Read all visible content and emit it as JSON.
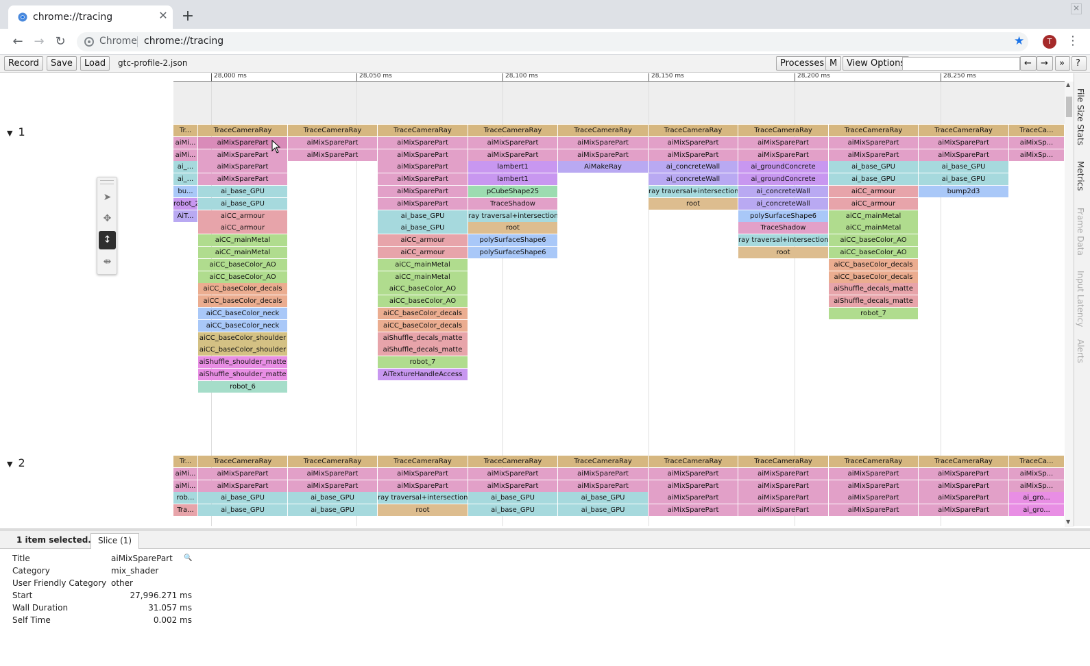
{
  "browser": {
    "tab_title": "chrome://tracing",
    "new_tab_symbol": "+",
    "close_symbol": "✕",
    "window_close_symbol": "✕",
    "omnibox_chip": "Chrome",
    "url": "chrome://tracing",
    "avatar_initial": "T",
    "nav_icons": [
      "back-arrow-icon",
      "forward-arrow-icon",
      "reload-icon"
    ],
    "accent": "#1a73e8",
    "avatar_color": "#a52a2a"
  },
  "tracing": {
    "buttons": {
      "record": "Record",
      "save": "Save",
      "load": "Load",
      "processes": "Processes",
      "m": "M",
      "view_options": "View Options",
      "prev": "←",
      "next": "→",
      "more": "»",
      "help": "?"
    },
    "filename": "gtc-profile-2.json",
    "search_value": "",
    "ruler_labels": [
      "28,000 ms",
      "28,050 ms",
      "28,100 ms",
      "28,150 ms",
      "28,200 ms",
      "28,250 ms"
    ],
    "threads": [
      {
        "id": "1",
        "expanded": true
      },
      {
        "id": "2",
        "expanded": true
      }
    ],
    "side_tabs": [
      "File Size Stats",
      "Metrics",
      "Frame Data",
      "Input Latency",
      "Alerts"
    ],
    "mouse_modes": [
      "selection-mode-icon",
      "pan-mode-icon",
      "zoom-mode-icon",
      "timing-mode-icon"
    ],
    "colors": {
      "tan": "#d6b780",
      "pink": "#e2a0c8",
      "pinkSel": "#d98bb9",
      "cyan": "#a6d9dd",
      "purple": "#c897f0",
      "lav": "#b9a9f2",
      "red": "#e7a4aa",
      "green": "#b0dc8e",
      "salmon": "#ebad90",
      "blue": "#a9c8f8",
      "olive": "#d4c184",
      "magenta": "#e88ee4",
      "teal": "#a5ddc9",
      "mint": "#9cdcb0",
      "sand": "#ddbd8f"
    },
    "columns": [
      {
        "blocks1": [
          [
            "Tr...",
            "tan"
          ],
          [
            "aiMi...",
            "pink"
          ],
          [
            "aiMi...",
            "pink"
          ],
          [
            "ai_...",
            "cyan"
          ],
          [
            "ai_...",
            "cyan"
          ],
          [
            "bu...",
            "blue"
          ],
          [
            "robot_2",
            "purple"
          ],
          [
            "AiT...",
            "lav"
          ]
        ],
        "blocks2": [
          [
            "Tr...",
            "tan"
          ],
          [
            "aiMi...",
            "pink"
          ],
          [
            "aiMi...",
            "pink"
          ],
          [
            "rob...",
            "cyan"
          ],
          [
            "Tra...",
            "red"
          ]
        ]
      },
      {
        "blocks1": [
          [
            "TraceCameraRay",
            "tan"
          ],
          [
            "aiMixSparePart",
            "pinkSel"
          ],
          [
            "aiMixSparePart",
            "pink"
          ],
          [
            "aiMixSparePart",
            "pink"
          ],
          [
            "aiMixSparePart",
            "pink"
          ],
          [
            "ai_base_GPU",
            "cyan"
          ],
          [
            "ai_base_GPU",
            "cyan"
          ],
          [
            "aiCC_armour",
            "red"
          ],
          [
            "aiCC_armour",
            "red"
          ],
          [
            "aiCC_mainMetal",
            "green"
          ],
          [
            "aiCC_mainMetal",
            "green"
          ],
          [
            "aiCC_baseColor_AO",
            "green"
          ],
          [
            "aiCC_baseColor_AO",
            "green"
          ],
          [
            "aiCC_baseColor_decals",
            "salmon"
          ],
          [
            "aiCC_baseColor_decals",
            "salmon"
          ],
          [
            "aiCC_baseColor_neck",
            "blue"
          ],
          [
            "aiCC_baseColor_neck",
            "blue"
          ],
          [
            "aiCC_baseColor_shoulder",
            "olive"
          ],
          [
            "aiCC_baseColor_shoulder",
            "olive"
          ],
          [
            "aiShuffle_shoulder_matte",
            "magenta"
          ],
          [
            "aiShuffle_shoulder_matte",
            "magenta"
          ],
          [
            "robot_6",
            "teal"
          ]
        ],
        "blocks2": [
          [
            "TraceCameraRay",
            "tan"
          ],
          [
            "aiMixSparePart",
            "pink"
          ],
          [
            "aiMixSparePart",
            "pink"
          ],
          [
            "ai_base_GPU",
            "cyan"
          ],
          [
            "ai_base_GPU",
            "cyan"
          ]
        ]
      },
      {
        "blocks1": [
          [
            "TraceCameraRay",
            "tan"
          ],
          [
            "aiMixSparePart",
            "pink"
          ],
          [
            "aiMixSparePart",
            "pink"
          ]
        ],
        "blocks2": [
          [
            "TraceCameraRay",
            "tan"
          ],
          [
            "aiMixSparePart",
            "pink"
          ],
          [
            "aiMixSparePart",
            "pink"
          ],
          [
            "ai_base_GPU",
            "cyan"
          ],
          [
            "ai_base_GPU",
            "cyan"
          ]
        ]
      },
      {
        "blocks1": [
          [
            "TraceCameraRay",
            "tan"
          ],
          [
            "aiMixSparePart",
            "pink"
          ],
          [
            "aiMixSparePart",
            "pink"
          ],
          [
            "aiMixSparePart",
            "pink"
          ],
          [
            "aiMixSparePart",
            "pink"
          ],
          [
            "aiMixSparePart",
            "pink"
          ],
          [
            "aiMixSparePart",
            "pink"
          ],
          [
            "ai_base_GPU",
            "cyan"
          ],
          [
            "ai_base_GPU",
            "cyan"
          ],
          [
            "aiCC_armour",
            "red"
          ],
          [
            "aiCC_armour",
            "red"
          ],
          [
            "aiCC_mainMetal",
            "green"
          ],
          [
            "aiCC_mainMetal",
            "green"
          ],
          [
            "aiCC_baseColor_AO",
            "green"
          ],
          [
            "aiCC_baseColor_AO",
            "green"
          ],
          [
            "aiCC_baseColor_decals",
            "salmon"
          ],
          [
            "aiCC_baseColor_decals",
            "salmon"
          ],
          [
            "aiShuffle_decals_matte",
            "red"
          ],
          [
            "aiShuffle_decals_matte",
            "red"
          ],
          [
            "robot_7",
            "green"
          ],
          [
            "AiTextureHandleAccess",
            "purple"
          ]
        ],
        "blocks2": [
          [
            "TraceCameraRay",
            "tan"
          ],
          [
            "aiMixSparePart",
            "pink"
          ],
          [
            "aiMixSparePart",
            "pink"
          ],
          [
            "ray traversal+intersection",
            "cyan"
          ],
          [
            "root",
            "sand"
          ]
        ]
      },
      {
        "blocks1": [
          [
            "TraceCameraRay",
            "tan"
          ],
          [
            "aiMixSparePart",
            "pink"
          ],
          [
            "aiMixSparePart",
            "pink"
          ],
          [
            "lambert1",
            "purple"
          ],
          [
            "lambert1",
            "purple"
          ],
          [
            "pCubeShape25",
            "mint"
          ],
          [
            "TraceShadow",
            "pink"
          ],
          [
            "ray traversal+intersection",
            "cyan"
          ],
          [
            "root",
            "sand"
          ],
          [
            "polySurfaceShape6",
            "blue"
          ],
          [
            "polySurfaceShape6",
            "blue"
          ]
        ],
        "blocks2": [
          [
            "TraceCameraRay",
            "tan"
          ],
          [
            "aiMixSparePart",
            "pink"
          ],
          [
            "aiMixSparePart",
            "pink"
          ],
          [
            "ai_base_GPU",
            "cyan"
          ],
          [
            "ai_base_GPU",
            "cyan"
          ]
        ]
      },
      {
        "blocks1": [
          [
            "TraceCameraRay",
            "tan"
          ],
          [
            "aiMixSparePart",
            "pink"
          ],
          [
            "aiMixSparePart",
            "pink"
          ],
          [
            "AiMakeRay",
            "lav"
          ]
        ],
        "blocks2": [
          [
            "TraceCameraRay",
            "tan"
          ],
          [
            "aiMixSparePart",
            "pink"
          ],
          [
            "aiMixSparePart",
            "pink"
          ],
          [
            "ai_base_GPU",
            "cyan"
          ],
          [
            "ai_base_GPU",
            "cyan"
          ]
        ]
      },
      {
        "blocks1": [
          [
            "TraceCameraRay",
            "tan"
          ],
          [
            "aiMixSparePart",
            "pink"
          ],
          [
            "aiMixSparePart",
            "pink"
          ],
          [
            "ai_concreteWall",
            "lav"
          ],
          [
            "ai_concreteWall",
            "lav"
          ],
          [
            "ray traversal+intersection",
            "cyan"
          ],
          [
            "root",
            "sand"
          ]
        ],
        "blocks2": [
          [
            "TraceCameraRay",
            "tan"
          ],
          [
            "aiMixSparePart",
            "pink"
          ],
          [
            "aiMixSparePart",
            "pink"
          ],
          [
            "aiMixSparePart",
            "pink"
          ],
          [
            "aiMixSparePart",
            "pink"
          ]
        ]
      },
      {
        "blocks1": [
          [
            "TraceCameraRay",
            "tan"
          ],
          [
            "aiMixSparePart",
            "pink"
          ],
          [
            "aiMixSparePart",
            "pink"
          ],
          [
            "ai_groundConcrete",
            "purple"
          ],
          [
            "ai_groundConcrete",
            "purple"
          ],
          [
            "ai_concreteWall",
            "lav"
          ],
          [
            "ai_concreteWall",
            "lav"
          ],
          [
            "polySurfaceShape6",
            "blue"
          ],
          [
            "TraceShadow",
            "pink"
          ],
          [
            "ray traversal+intersection",
            "cyan"
          ],
          [
            "root",
            "sand"
          ]
        ],
        "blocks2": [
          [
            "TraceCameraRay",
            "tan"
          ],
          [
            "aiMixSparePart",
            "pink"
          ],
          [
            "aiMixSparePart",
            "pink"
          ],
          [
            "aiMixSparePart",
            "pink"
          ],
          [
            "aiMixSparePart",
            "pink"
          ]
        ]
      },
      {
        "blocks1": [
          [
            "TraceCameraRay",
            "tan"
          ],
          [
            "aiMixSparePart",
            "pink"
          ],
          [
            "aiMixSparePart",
            "pink"
          ],
          [
            "ai_base_GPU",
            "cyan"
          ],
          [
            "ai_base_GPU",
            "cyan"
          ],
          [
            "aiCC_armour",
            "red"
          ],
          [
            "aiCC_armour",
            "red"
          ],
          [
            "aiCC_mainMetal",
            "green"
          ],
          [
            "aiCC_mainMetal",
            "green"
          ],
          [
            "aiCC_baseColor_AO",
            "green"
          ],
          [
            "aiCC_baseColor_AO",
            "green"
          ],
          [
            "aiCC_baseColor_decals",
            "salmon"
          ],
          [
            "aiCC_baseColor_decals",
            "salmon"
          ],
          [
            "aiShuffle_decals_matte",
            "red"
          ],
          [
            "aiShuffle_decals_matte",
            "red"
          ],
          [
            "robot_7",
            "green"
          ]
        ],
        "blocks2": [
          [
            "TraceCameraRay",
            "tan"
          ],
          [
            "aiMixSparePart",
            "pink"
          ],
          [
            "aiMixSparePart",
            "pink"
          ],
          [
            "aiMixSparePart",
            "pink"
          ],
          [
            "aiMixSparePart",
            "pink"
          ]
        ]
      },
      {
        "blocks1": [
          [
            "TraceCameraRay",
            "tan"
          ],
          [
            "aiMixSparePart",
            "pink"
          ],
          [
            "aiMixSparePart",
            "pink"
          ],
          [
            "ai_base_GPU",
            "cyan"
          ],
          [
            "ai_base_GPU",
            "cyan"
          ],
          [
            "bump2d3",
            "blue"
          ]
        ],
        "blocks2": [
          [
            "TraceCameraRay",
            "tan"
          ],
          [
            "aiMixSparePart",
            "pink"
          ],
          [
            "aiMixSparePart",
            "pink"
          ],
          [
            "aiMixSparePart",
            "pink"
          ],
          [
            "aiMixSparePart",
            "pink"
          ]
        ]
      },
      {
        "blocks1": [
          [
            "TraceCa...",
            "tan"
          ],
          [
            "aiMixSp...",
            "pink"
          ],
          [
            "aiMixSp...",
            "pink"
          ]
        ],
        "blocks2": [
          [
            "TraceCa...",
            "tan"
          ],
          [
            "aiMixSp...",
            "pink"
          ],
          [
            "aiMixSp...",
            "pink"
          ],
          [
            "ai_gro...",
            "magenta"
          ],
          [
            "ai_gro...",
            "magenta"
          ]
        ]
      }
    ]
  },
  "details": {
    "selection_summary": "1 item selected.",
    "tab_label": "Slice (1)",
    "rows": [
      {
        "key": "Title",
        "value": "aiMixSparePart",
        "numeric": false
      },
      {
        "key": "Category",
        "value": "mix_shader",
        "numeric": false
      },
      {
        "key": "User Friendly Category",
        "value": "other",
        "numeric": false
      },
      {
        "key": "Start",
        "value": "27,996.271 ms",
        "numeric": true
      },
      {
        "key": "Wall Duration",
        "value": "31.057 ms",
        "numeric": true
      },
      {
        "key": "Self Time",
        "value": "0.002 ms",
        "numeric": true
      }
    ]
  }
}
